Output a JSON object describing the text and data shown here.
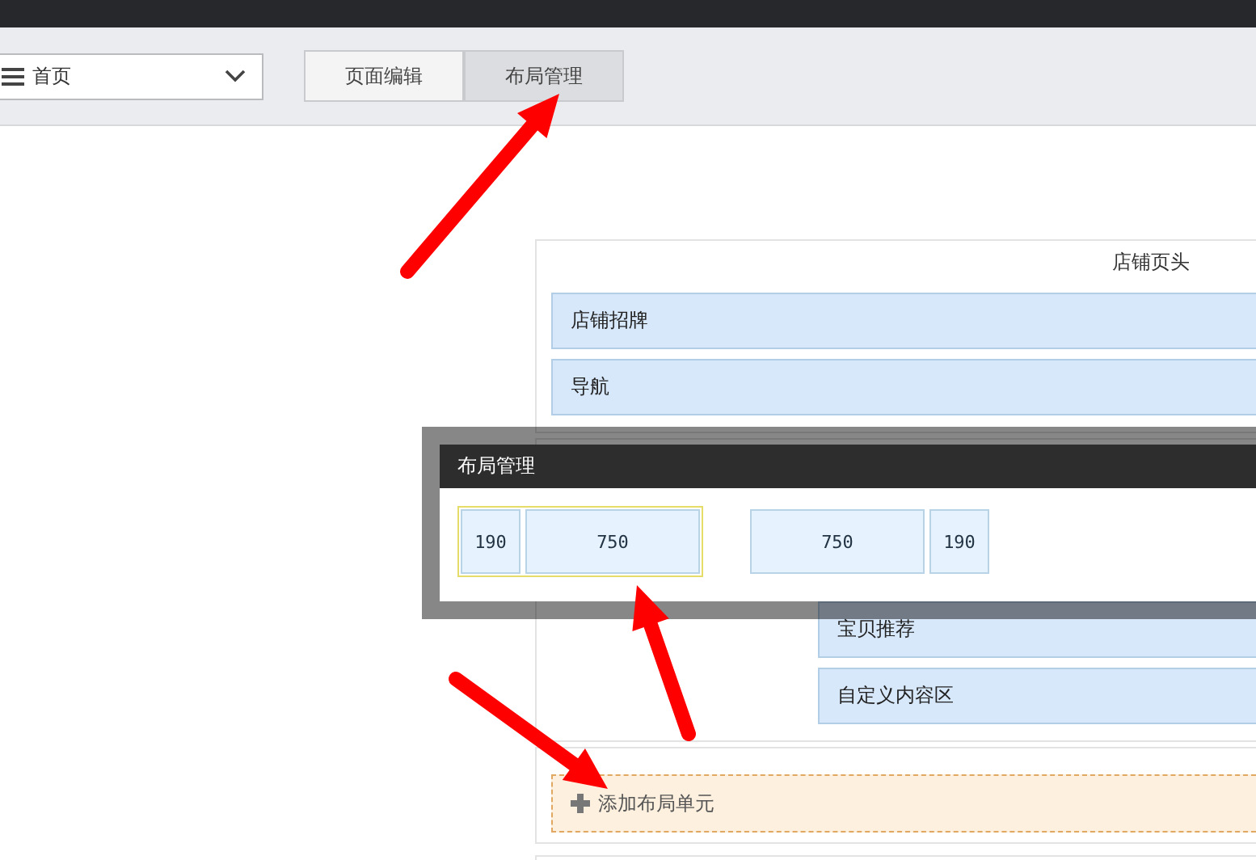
{
  "toolbar": {
    "page_select": {
      "value": "首页"
    },
    "tabs": [
      {
        "label": "页面编辑",
        "selected": false
      },
      {
        "label": "布局管理",
        "selected": true
      }
    ]
  },
  "header_section": {
    "title": "店铺页头",
    "modules": [
      "店铺招牌",
      "导航"
    ]
  },
  "body_section": {
    "modules": [
      "宝贝推荐",
      "自定义内容区"
    ]
  },
  "add_layout": {
    "label": "添加布局单元"
  },
  "layout_dialog": {
    "title": "布局管理",
    "layouts": [
      {
        "selected": true,
        "columns": [
          {
            "kind": "narrow",
            "label": "190"
          },
          {
            "kind": "wide",
            "label": "750"
          }
        ]
      },
      {
        "selected": false,
        "columns": [
          {
            "kind": "wide",
            "label": "750"
          },
          {
            "kind": "narrow",
            "label": "190"
          }
        ]
      }
    ]
  }
}
